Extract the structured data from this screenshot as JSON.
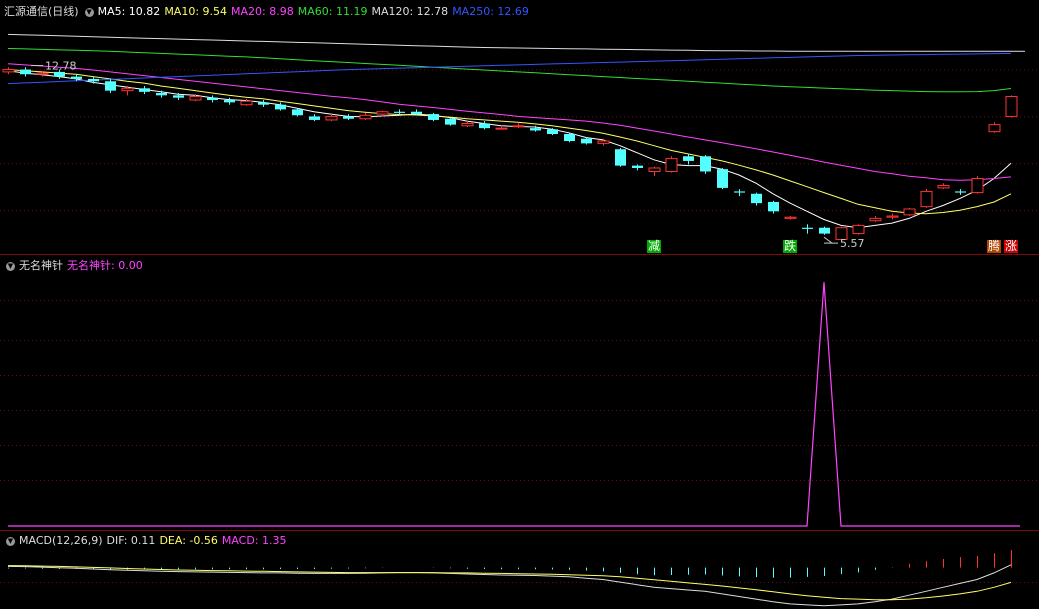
{
  "main_panel": {
    "title": "汇源通信(日线)",
    "legend": [
      {
        "label": "MA5: 10.82",
        "color": "#ffffff"
      },
      {
        "label": "MA10: 9.54",
        "color": "#ffff66"
      },
      {
        "label": "MA20: 8.98",
        "color": "#ff44ff"
      },
      {
        "label": "MA60: 11.19",
        "color": "#33dd33"
      },
      {
        "label": "MA120: 12.78",
        "color": "#dddddd"
      },
      {
        "label": "MA250: 12.69",
        "color": "#3355ff"
      }
    ],
    "signals": [
      {
        "text": "减",
        "bg": "#00aa00",
        "color": "#ffffff",
        "index": 38
      },
      {
        "text": "跌",
        "bg": "#00aa00",
        "color": "#ffffff",
        "index": 46
      },
      {
        "text": "腾",
        "bg": "#b04400",
        "color": "#ffffff",
        "index": 58
      },
      {
        "text": "涨",
        "bg": "#cc0000",
        "color": "#ffffff",
        "index": 59
      }
    ]
  },
  "indicator_panel": {
    "name": "无名神针",
    "value_label": "无名神针: 0.00",
    "color": "#ff44ff"
  },
  "macd_panel": {
    "name": "MACD(12,26,9)",
    "dif_label": "DIF: 0.11",
    "dea_label": "DEA: -0.56",
    "macd_label": "MACD: 1.35",
    "dif_color": "#dddddd",
    "dea_color": "#ffff66",
    "macd_color": "#ff44ff"
  },
  "chart_data": {
    "type": "candlestick",
    "candles": [
      [
        11.9,
        12.0,
        12.1,
        11.8
      ],
      [
        12.0,
        11.8,
        12.1,
        11.7
      ],
      [
        11.8,
        11.85,
        11.95,
        11.7
      ],
      [
        11.9,
        11.7,
        12.0,
        11.6
      ],
      [
        11.7,
        11.6,
        11.8,
        11.5
      ],
      [
        11.6,
        11.5,
        11.7,
        11.4
      ],
      [
        11.5,
        11.1,
        11.6,
        11.0
      ],
      [
        11.1,
        11.2,
        11.3,
        10.9
      ],
      [
        11.2,
        11.05,
        11.3,
        10.95
      ],
      [
        11.0,
        10.9,
        11.1,
        10.8
      ],
      [
        10.9,
        10.8,
        11.0,
        10.7
      ],
      [
        10.7,
        10.85,
        10.95,
        10.65
      ],
      [
        10.8,
        10.7,
        10.9,
        10.6
      ],
      [
        10.7,
        10.6,
        10.8,
        10.5
      ],
      [
        10.5,
        10.65,
        10.75,
        10.45
      ],
      [
        10.6,
        10.5,
        10.7,
        10.4
      ],
      [
        10.5,
        10.3,
        10.6,
        10.25
      ],
      [
        10.3,
        10.05,
        10.35,
        10.0
      ],
      [
        10.0,
        9.85,
        10.1,
        9.8
      ],
      [
        9.85,
        10.0,
        10.1,
        9.8
      ],
      [
        10.0,
        9.9,
        10.1,
        9.85
      ],
      [
        9.9,
        10.05,
        10.15,
        9.85
      ],
      [
        10.1,
        10.2,
        10.25,
        10.0
      ],
      [
        10.2,
        10.15,
        10.3,
        10.1
      ],
      [
        10.2,
        10.1,
        10.3,
        10.05
      ],
      [
        10.1,
        9.85,
        10.15,
        9.8
      ],
      [
        9.9,
        9.65,
        9.95,
        9.6
      ],
      [
        9.6,
        9.7,
        9.8,
        9.55
      ],
      [
        9.7,
        9.5,
        9.8,
        9.45
      ],
      [
        9.5,
        9.5,
        9.6,
        9.45
      ],
      [
        9.6,
        9.6,
        9.7,
        9.5
      ],
      [
        9.5,
        9.4,
        9.6,
        9.35
      ],
      [
        9.45,
        9.25,
        9.5,
        9.2
      ],
      [
        9.25,
        8.95,
        9.3,
        8.9
      ],
      [
        9.05,
        8.85,
        9.1,
        8.8
      ],
      [
        8.85,
        8.95,
        9.05,
        8.75
      ],
      [
        8.6,
        7.9,
        8.65,
        7.85
      ],
      [
        7.9,
        7.8,
        7.95,
        7.7
      ],
      [
        7.65,
        7.8,
        7.85,
        7.45
      ],
      [
        7.65,
        8.2,
        8.3,
        7.6
      ],
      [
        8.3,
        8.1,
        8.4,
        7.95
      ],
      [
        8.3,
        7.65,
        8.35,
        7.55
      ],
      [
        7.75,
        6.95,
        7.8,
        6.9
      ],
      [
        6.8,
        6.75,
        6.9,
        6.6
      ],
      [
        6.7,
        6.3,
        6.75,
        6.2
      ],
      [
        6.35,
        5.95,
        6.4,
        5.85
      ],
      [
        5.65,
        5.7,
        5.75,
        5.6
      ],
      [
        5.25,
        5.2,
        5.4,
        5.0
      ],
      [
        5.25,
        5.0,
        5.3,
        4.95
      ],
      [
        4.75,
        5.25,
        5.3,
        4.65
      ],
      [
        5.0,
        5.35,
        5.4,
        4.95
      ],
      [
        5.55,
        5.65,
        5.75,
        5.5
      ],
      [
        5.7,
        5.75,
        5.85,
        5.6
      ],
      [
        5.8,
        6.05,
        6.1,
        5.75
      ],
      [
        6.15,
        6.8,
        6.9,
        6.1
      ],
      [
        6.95,
        7.05,
        7.15,
        6.9
      ],
      [
        6.8,
        6.75,
        6.9,
        6.65
      ],
      [
        6.75,
        7.35,
        7.45,
        6.7
      ],
      [
        9.35,
        9.65,
        9.75,
        9.3
      ],
      [
        10.0,
        10.85,
        10.9,
        9.95
      ]
    ],
    "annotations": [
      {
        "text": "12.78",
        "index": 1,
        "value": 12.0
      },
      {
        "text": "5.57",
        "index": 48,
        "value": 4.85
      }
    ],
    "ma": {
      "MA5": {
        "color": "#ffffff",
        "values": [
          11.95,
          11.85,
          11.78,
          11.7,
          11.6,
          11.45,
          11.35,
          11.25,
          11.15,
          11.05,
          10.95,
          10.9,
          10.8,
          10.72,
          10.68,
          10.6,
          10.5,
          10.35,
          10.2,
          10.1,
          10.0,
          9.98,
          10.02,
          10.05,
          10.1,
          10.05,
          9.95,
          9.8,
          9.7,
          9.6,
          9.57,
          9.55,
          9.45,
          9.3,
          9.1,
          9.0,
          8.75,
          8.45,
          8.15,
          7.95,
          7.9,
          7.9,
          7.75,
          7.5,
          7.15,
          6.7,
          6.3,
          5.95,
          5.6,
          5.35,
          5.25,
          5.35,
          5.45,
          5.65,
          5.95,
          6.2,
          6.5,
          6.85,
          7.35,
          8.0
        ]
      },
      "MA10": {
        "color": "#ffff66",
        "values": [
          12.0,
          11.95,
          11.9,
          11.85,
          11.8,
          11.7,
          11.6,
          11.5,
          11.42,
          11.3,
          11.2,
          11.1,
          11.0,
          10.9,
          10.82,
          10.75,
          10.65,
          10.55,
          10.45,
          10.35,
          10.25,
          10.18,
          10.12,
          10.08,
          10.06,
          10.02,
          9.97,
          9.9,
          9.85,
          9.8,
          9.75,
          9.68,
          9.6,
          9.5,
          9.4,
          9.28,
          9.12,
          8.95,
          8.75,
          8.55,
          8.4,
          8.25,
          8.1,
          7.92,
          7.72,
          7.5,
          7.25,
          7.0,
          6.75,
          6.5,
          6.25,
          6.1,
          5.95,
          5.88,
          5.85,
          5.9,
          6.0,
          6.15,
          6.35,
          6.7
        ]
      },
      "MA20": {
        "color": "#ff44ff",
        "values": [
          12.25,
          12.2,
          12.15,
          12.1,
          12.05,
          11.98,
          11.9,
          11.82,
          11.74,
          11.66,
          11.58,
          11.5,
          11.42,
          11.34,
          11.26,
          11.18,
          11.1,
          11.02,
          10.94,
          10.86,
          10.8,
          10.72,
          10.62,
          10.52,
          10.45,
          10.38,
          10.3,
          10.22,
          10.15,
          10.08,
          10.0,
          9.95,
          9.9,
          9.85,
          9.8,
          9.72,
          9.62,
          9.5,
          9.38,
          9.25,
          9.12,
          9.0,
          8.88,
          8.75,
          8.62,
          8.48,
          8.34,
          8.2,
          8.05,
          7.92,
          7.78,
          7.65,
          7.55,
          7.45,
          7.38,
          7.3,
          7.28,
          7.3,
          7.35,
          7.42
        ]
      },
      "MA60": {
        "color": "#33dd33",
        "values": [
          12.9,
          12.88,
          12.86,
          12.84,
          12.82,
          12.8,
          12.78,
          12.75,
          12.72,
          12.69,
          12.66,
          12.63,
          12.6,
          12.57,
          12.54,
          12.5,
          12.46,
          12.42,
          12.38,
          12.34,
          12.3,
          12.26,
          12.22,
          12.18,
          12.14,
          12.1,
          12.06,
          12.02,
          11.98,
          11.94,
          11.9,
          11.86,
          11.82,
          11.78,
          11.74,
          11.7,
          11.66,
          11.62,
          11.58,
          11.54,
          11.5,
          11.46,
          11.42,
          11.38,
          11.34,
          11.3,
          11.27,
          11.24,
          11.21,
          11.18,
          11.15,
          11.12,
          11.1,
          11.08,
          11.06,
          11.05,
          11.05,
          11.06,
          11.1,
          11.19
        ]
      },
      "MA120": {
        "color": "#dddddd",
        "values": [
          13.5,
          13.48,
          13.46,
          13.44,
          13.42,
          13.4,
          13.38,
          13.36,
          13.34,
          13.32,
          13.3,
          13.28,
          13.26,
          13.24,
          13.22,
          13.2,
          13.18,
          13.16,
          13.14,
          13.12,
          13.1,
          13.08,
          13.06,
          13.04,
          13.02,
          13.0,
          12.98,
          12.96,
          12.94,
          12.93,
          12.92,
          12.91,
          12.9,
          12.89,
          12.88,
          12.87,
          12.86,
          12.85,
          12.84,
          12.83,
          12.82,
          12.81,
          12.8,
          12.8,
          12.79,
          12.79,
          12.78,
          12.78,
          12.78,
          12.78,
          12.78,
          12.78,
          12.78,
          12.78,
          12.78,
          12.78,
          12.78,
          12.78,
          12.78,
          12.78
        ]
      },
      "MA250": {
        "color": "#3355ff",
        "values": [
          11.4,
          11.43,
          11.46,
          11.49,
          11.52,
          11.55,
          11.58,
          11.61,
          11.64,
          11.67,
          11.7,
          11.73,
          11.76,
          11.79,
          11.82,
          11.85,
          11.88,
          11.91,
          11.94,
          11.97,
          12.0,
          12.02,
          12.04,
          12.06,
          12.08,
          12.1,
          12.12,
          12.14,
          12.16,
          12.18,
          12.2,
          12.22,
          12.24,
          12.26,
          12.28,
          12.3,
          12.32,
          12.34,
          12.36,
          12.38,
          12.4,
          12.42,
          12.44,
          12.46,
          12.48,
          12.5,
          12.52,
          12.54,
          12.56,
          12.58,
          12.6,
          12.61,
          12.62,
          12.63,
          12.64,
          12.65,
          12.66,
          12.67,
          12.68,
          12.69
        ]
      }
    },
    "indicator": {
      "index_of_spike": 48,
      "spike_value": 1.0,
      "ylim": [
        0,
        1.05
      ]
    },
    "macd": {
      "dif": [
        0.05,
        0.04,
        0.02,
        0.0,
        -0.02,
        -0.05,
        -0.08,
        -0.1,
        -0.12,
        -0.14,
        -0.15,
        -0.16,
        -0.17,
        -0.18,
        -0.19,
        -0.2,
        -0.2,
        -0.21,
        -0.22,
        -0.22,
        -0.22,
        -0.21,
        -0.2,
        -0.19,
        -0.19,
        -0.2,
        -0.22,
        -0.24,
        -0.26,
        -0.28,
        -0.29,
        -0.3,
        -0.32,
        -0.35,
        -0.4,
        -0.45,
        -0.55,
        -0.65,
        -0.75,
        -0.8,
        -0.85,
        -0.9,
        -1.0,
        -1.1,
        -1.2,
        -1.3,
        -1.38,
        -1.42,
        -1.45,
        -1.42,
        -1.38,
        -1.3,
        -1.2,
        -1.05,
        -0.9,
        -0.75,
        -0.6,
        -0.45,
        -0.2,
        0.11
      ],
      "dea": [
        0.08,
        0.07,
        0.06,
        0.05,
        0.03,
        0.01,
        -0.01,
        -0.03,
        -0.05,
        -0.07,
        -0.09,
        -0.1,
        -0.11,
        -0.12,
        -0.13,
        -0.14,
        -0.15,
        -0.16,
        -0.17,
        -0.18,
        -0.19,
        -0.19,
        -0.19,
        -0.19,
        -0.19,
        -0.19,
        -0.2,
        -0.2,
        -0.21,
        -0.22,
        -0.23,
        -0.24,
        -0.25,
        -0.27,
        -0.29,
        -0.31,
        -0.35,
        -0.4,
        -0.46,
        -0.52,
        -0.58,
        -0.64,
        -0.7,
        -0.77,
        -0.84,
        -0.92,
        -1.0,
        -1.07,
        -1.13,
        -1.18,
        -1.2,
        -1.22,
        -1.22,
        -1.2,
        -1.15,
        -1.08,
        -1.0,
        -0.9,
        -0.75,
        -0.56
      ],
      "hist": [
        -0.03,
        -0.03,
        -0.04,
        -0.05,
        -0.05,
        -0.06,
        -0.07,
        -0.07,
        -0.07,
        -0.07,
        -0.06,
        -0.06,
        -0.06,
        -0.06,
        -0.06,
        -0.06,
        -0.05,
        -0.05,
        -0.05,
        -0.04,
        -0.03,
        -0.02,
        -0.01,
        0.0,
        0.0,
        -0.01,
        -0.02,
        -0.04,
        -0.05,
        -0.06,
        -0.06,
        -0.06,
        -0.07,
        -0.08,
        -0.11,
        -0.14,
        -0.2,
        -0.25,
        -0.29,
        -0.28,
        -0.27,
        -0.26,
        -0.3,
        -0.33,
        -0.36,
        -0.38,
        -0.38,
        -0.35,
        -0.32,
        -0.24,
        -0.18,
        -0.08,
        0.02,
        0.15,
        0.25,
        0.33,
        0.4,
        0.45,
        0.55,
        0.67
      ]
    }
  }
}
